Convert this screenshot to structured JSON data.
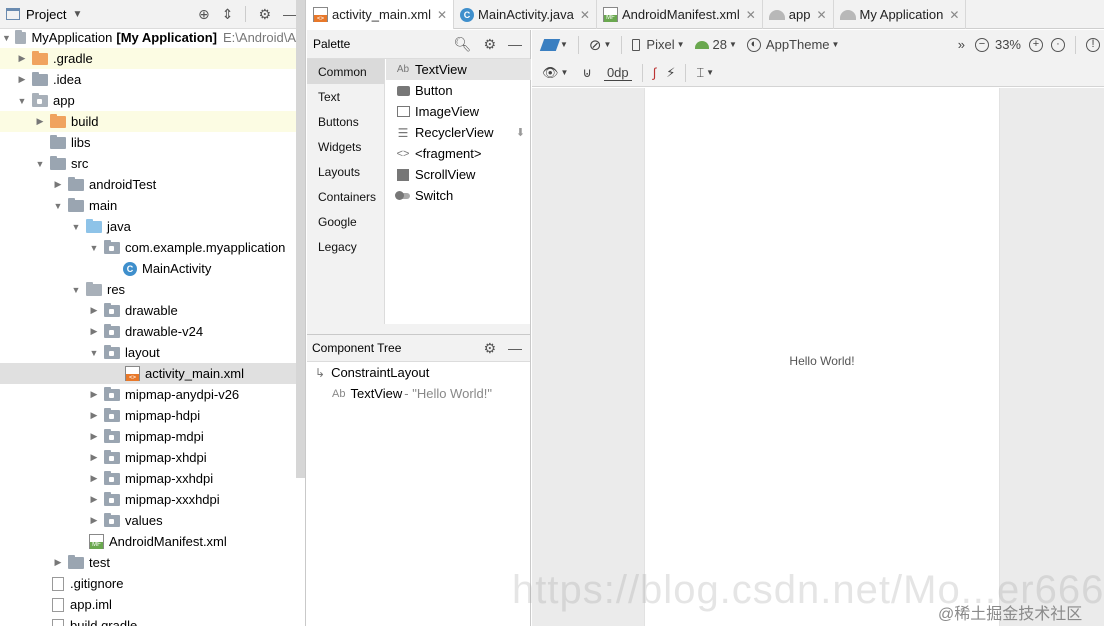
{
  "project_panel": {
    "title": "Project",
    "tree": [
      {
        "label": "MyApplication",
        "extra_bold": "[My Application]",
        "extra_path": "E:\\Android\\A"
      },
      {
        "label": ".gradle"
      },
      {
        "label": ".idea"
      },
      {
        "label": "app"
      },
      {
        "label": "build"
      },
      {
        "label": "libs"
      },
      {
        "label": "src"
      },
      {
        "label": "androidTest"
      },
      {
        "label": "main"
      },
      {
        "label": "java"
      },
      {
        "label": "com.example.myapplication"
      },
      {
        "label": "MainActivity"
      },
      {
        "label": "res"
      },
      {
        "label": "drawable"
      },
      {
        "label": "drawable-v24"
      },
      {
        "label": "layout"
      },
      {
        "label": "activity_main.xml"
      },
      {
        "label": "mipmap-anydpi-v26"
      },
      {
        "label": "mipmap-hdpi"
      },
      {
        "label": "mipmap-mdpi"
      },
      {
        "label": "mipmap-xhdpi"
      },
      {
        "label": "mipmap-xxhdpi"
      },
      {
        "label": "mipmap-xxxhdpi"
      },
      {
        "label": "values"
      },
      {
        "label": "AndroidManifest.xml"
      },
      {
        "label": "test"
      },
      {
        "label": ".gitignore"
      },
      {
        "label": "app.iml"
      },
      {
        "label": "build.gradle"
      }
    ]
  },
  "tabs": [
    {
      "label": "activity_main.xml"
    },
    {
      "label": "MainActivity.java"
    },
    {
      "label": "AndroidManifest.xml"
    },
    {
      "label": "app"
    },
    {
      "label": "My Application"
    }
  ],
  "palette": {
    "title": "Palette",
    "categories": [
      "Common",
      "Text",
      "Buttons",
      "Widgets",
      "Layouts",
      "Containers",
      "Google",
      "Legacy"
    ],
    "items": [
      "TextView",
      "Button",
      "ImageView",
      "RecyclerView",
      "<fragment>",
      "ScrollView",
      "Switch"
    ],
    "textview_prefix": "Ab"
  },
  "component_tree": {
    "title": "Component Tree",
    "root": "ConstraintLayout",
    "child_prefix": "Ab",
    "child": "TextView",
    "child_value": "- \"Hello World!\""
  },
  "toolbar": {
    "device": "Pixel",
    "api": "28",
    "theme": "AppTheme",
    "zoom": "33%",
    "margin": "0dp",
    "overflow": "»"
  },
  "canvas": {
    "hello_text": "Hello World!"
  },
  "watermark": {
    "url": "https://blog.csdn.net/Mo...er666",
    "site": "@稀土掘金技术社区"
  },
  "colors": {
    "accent": "#3a7fc1",
    "highlight_row": "#fcfce3",
    "selected_row": "#e0e0e0"
  }
}
